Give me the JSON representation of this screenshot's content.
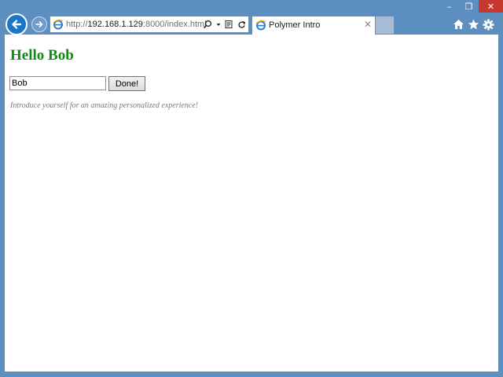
{
  "window": {
    "caption_buttons": {
      "minimize": "–",
      "maximize": "❐",
      "close": "✕"
    },
    "accent_color": "#5c8ebf",
    "close_color": "#c7382f"
  },
  "navigation": {
    "back_icon": "back-arrow-icon",
    "forward_icon": "forward-arrow-icon"
  },
  "address_bar": {
    "url_prefix": "http://",
    "url_host": "192.168.1.129",
    "url_rest": ":8000/index.html",
    "tool_icons": [
      "search-icon",
      "dropdown-icon",
      "compatibility-view-icon",
      "refresh-icon"
    ]
  },
  "tabs": [
    {
      "title": "Polymer Intro",
      "active": true,
      "close_glyph": "✕"
    }
  ],
  "toolbar_right": {
    "home_icon": "home-icon",
    "favorites_icon": "favorites-star-icon",
    "tools_icon": "gear-icon"
  },
  "page": {
    "greeting": "Hello Bob",
    "greeting_color": "#138a13",
    "name_input_value": "Bob",
    "done_button_label": "Done!",
    "intro_text": "Introduce yourself for an amazing personalized experience!"
  }
}
